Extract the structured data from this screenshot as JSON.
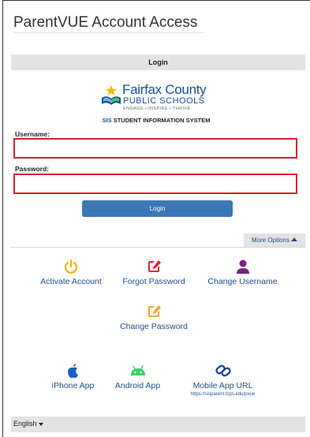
{
  "page": {
    "title": "ParentVUE Account Access"
  },
  "login_panel": {
    "header": "Login"
  },
  "logo": {
    "name": "Fairfax County",
    "sub": "PUBLIC SCHOOLS",
    "tagline": "ENGAGE • INSPIRE • THRIVE",
    "sis_prefix": "SIS",
    "sis_text": " STUDENT INFORMATION SYSTEM"
  },
  "form": {
    "username_label": "Username:",
    "username_value": "",
    "password_label": "Password:",
    "password_value": "",
    "login_button": "Login"
  },
  "more_options": {
    "label": "More Options"
  },
  "actions": [
    {
      "label": "Activate Account",
      "icon": "power-icon",
      "color": "#f5b400"
    },
    {
      "label": "Forgot Password",
      "icon": "edit-icon",
      "color": "#e0242f"
    },
    {
      "label": "Change Username",
      "icon": "user-icon",
      "color": "#7a1f86"
    },
    {
      "label": "Change Password",
      "icon": "edit-icon",
      "color": "#f0a830"
    }
  ],
  "apps": [
    {
      "label": "iPhone App",
      "icon": "apple-icon",
      "color": "#1a5fc2"
    },
    {
      "label": "Android App",
      "icon": "android-icon",
      "color": "#3dd168"
    },
    {
      "label": "Mobile App URL",
      "sub": "https://sisparent.fcps.edu/pvue",
      "icon": "link-icon",
      "color": "#1a3f9a"
    }
  ],
  "footer": {
    "language": "English"
  },
  "colors": {
    "accent": "#3b78b4",
    "error_border": "#d9202b",
    "link": "#1f4f8a"
  }
}
